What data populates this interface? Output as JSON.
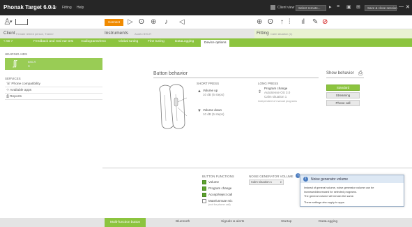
{
  "titlebar": {
    "app_title": "Phonak Target 6.0.1",
    "menu": [
      "File",
      "Fitting",
      "Help"
    ],
    "client_view": "Client view",
    "select_remote": "Select remote...",
    "save_close": "Save & close session",
    "window_controls": [
      "minimize-icon",
      "close-icon"
    ]
  },
  "toolbar": {
    "connect_label": "Connect"
  },
  "header": {
    "client_title": "Client",
    "client_sub": "Female retired person, Trainer",
    "instruments_title": "Instruments",
    "instruments_sub": "Audéo B90-R",
    "fitting_title": "Fitting",
    "fitting_sub": "Calm situation (1)"
  },
  "tabs": {
    "back": "< 50 >",
    "items": [
      "Feedback and real ear test",
      "AudiogramDirect",
      "Global tuning",
      "Fine tuning",
      "DataLogging",
      "Device options"
    ],
    "active_index": 5
  },
  "left": {
    "hearing_aids_label": "HEARING AIDS",
    "aid_name": "B90-R",
    "aid_sub": "R",
    "services_label": "SERVICES",
    "services": [
      "Phone compatibility",
      "Available apps",
      "Reports"
    ]
  },
  "main": {
    "section_title": "Button behavior",
    "show_behavior_label": "Show behavior",
    "behavior_options": [
      "Standard",
      "Streaming",
      "Phone call"
    ],
    "behavior_active": 0,
    "short_press_label": "SHORT PRESS",
    "short_press_up": "Volume up",
    "short_press_up_sub": "10 dB (5 steps)",
    "short_press_down": "Volume down",
    "short_press_down_sub": "10 dB (5 steps)",
    "long_press_label": "LONG PRESS",
    "long_press_title": "Program change",
    "long_press_line1": "AutoSense OS 3.0",
    "long_press_line2": "Calm situation 1",
    "long_press_note": "Independent of manual programs"
  },
  "functions": {
    "title": "BUTTON FUNCTIONS",
    "items": [
      {
        "label": "Volume",
        "checked": true
      },
      {
        "label": "Program change",
        "checked": true
      },
      {
        "label": "Accept/reject call",
        "checked": true
      },
      {
        "label": "Mute/unmute mic",
        "checked": false
      }
    ],
    "mute_note": "(not for phone call)"
  },
  "noise": {
    "title": "NOISE GENERATOR VOLUME",
    "dropdown_value": "Calm situation 1"
  },
  "info": {
    "title": "Noise generator volume",
    "body1": "Instead of general volume, noise generator volume can be",
    "body2": "increased/decreased for selected programs.",
    "body3": "The general volume will remain the same.",
    "body4": "These settings also apply to apps."
  },
  "bottom_tabs": {
    "items": [
      "Multi-function button",
      "Bluetooth",
      "Signals & alerts",
      "Startup",
      "DataLogging"
    ],
    "active_index": 0
  },
  "colors": {
    "accent_green": "#8cc43f",
    "connect_orange": "#f08a00",
    "titlebar": "#262626"
  }
}
